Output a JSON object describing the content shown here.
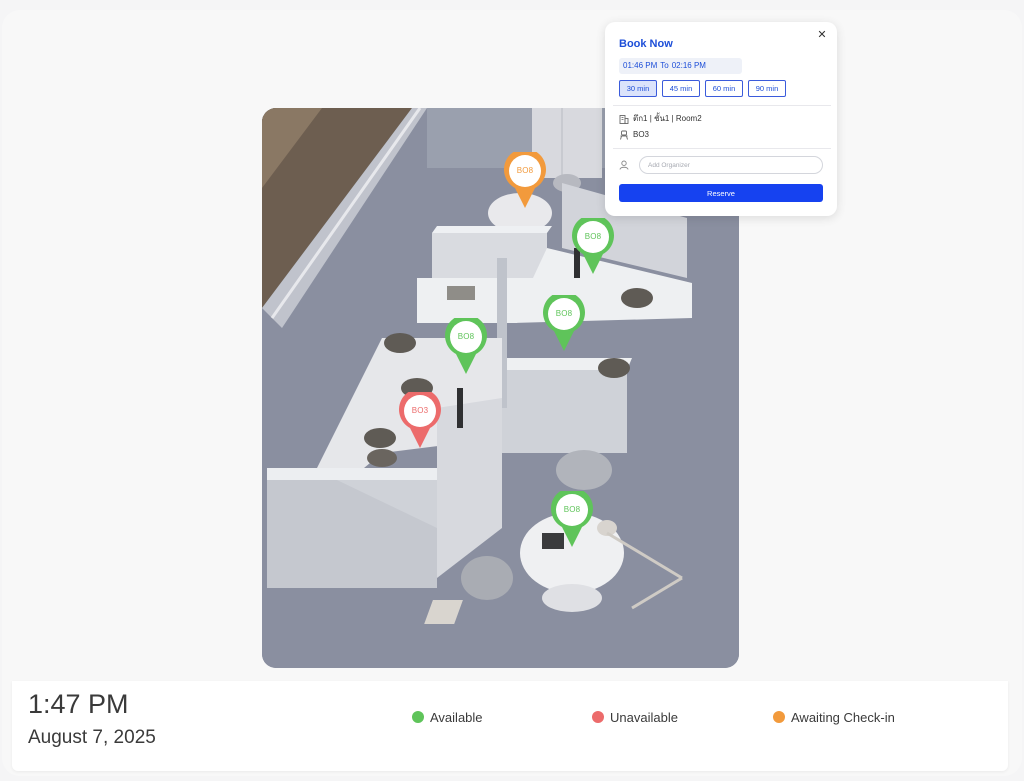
{
  "colors": {
    "available": "#5fc45a",
    "unavailable": "#ec6b6b",
    "awaiting": "#f29a3c",
    "accent": "#1642f0"
  },
  "desk_pins": [
    {
      "label": "BO8",
      "status": "awaiting"
    },
    {
      "label": "BO8",
      "status": "available"
    },
    {
      "label": "BO8",
      "status": "available"
    },
    {
      "label": "BO8",
      "status": "available"
    },
    {
      "label": "BO3",
      "status": "unavailable"
    },
    {
      "label": "BO8",
      "status": "available"
    }
  ],
  "booking": {
    "title": "Book Now",
    "close_icon": "close-icon",
    "start_time": "01:46 PM",
    "to_label": "To",
    "end_time": "02:16 PM",
    "durations": [
      "30 min",
      "45 min",
      "60 min",
      "90 min"
    ],
    "selected_duration": "30 min",
    "location": "ตึก1 | ชั้น1 | Room2",
    "location_icon": "building-icon",
    "desk": "BO3",
    "desk_icon": "chair-icon",
    "organizer_icon": "user-icon",
    "organizer_placeholder": "Add Organizer",
    "reserve_label": "Reserve"
  },
  "status_bar": {
    "time": "1:47 PM",
    "date": "August 7, 2025",
    "legend": [
      {
        "label": "Available",
        "status": "available"
      },
      {
        "label": "Unavailable",
        "status": "unavailable"
      },
      {
        "label": "Awaiting Check-in",
        "status": "awaiting"
      }
    ]
  }
}
